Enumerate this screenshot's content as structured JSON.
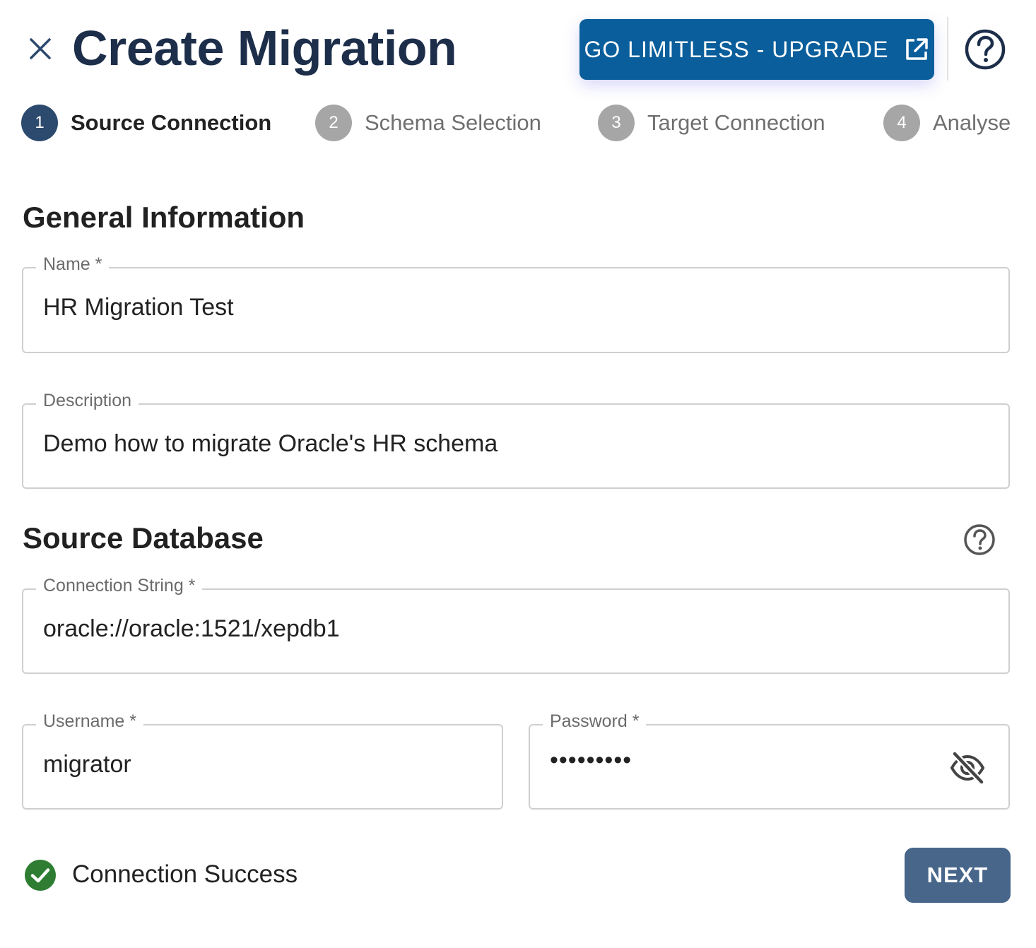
{
  "header": {
    "title": "Create Migration",
    "upgrade_label": "GO LIMITLESS - UPGRADE"
  },
  "stepper": {
    "steps": [
      {
        "number": "1",
        "label": "Source Connection",
        "active": true
      },
      {
        "number": "2",
        "label": "Schema Selection",
        "active": false
      },
      {
        "number": "3",
        "label": "Target Connection",
        "active": false
      },
      {
        "number": "4",
        "label": "Analyse",
        "active": false
      }
    ]
  },
  "general": {
    "title": "General Information",
    "name": {
      "label": "Name *",
      "value": "HR Migration Test"
    },
    "description": {
      "label": "Description",
      "value": "Demo how to migrate Oracle's HR schema"
    }
  },
  "source": {
    "title": "Source Database",
    "connection_string": {
      "label": "Connection String *",
      "value": "oracle://oracle:1521/xepdb1"
    },
    "username": {
      "label": "Username *",
      "value": "migrator"
    },
    "password": {
      "label": "Password *",
      "value": "•••••••••"
    }
  },
  "footer": {
    "status_text": "Connection Success",
    "next_label": "NEXT"
  },
  "colors": {
    "title": "#1d2e4a",
    "upgrade_button": "#0a5e9b",
    "active_step": "#2c4a6e",
    "inactive_step": "#a6a6a6",
    "success": "#2e7d32",
    "next_button": "#47668a"
  },
  "icons": {
    "close": "close-icon",
    "external_link": "external-link-icon",
    "help": "help-circle-icon",
    "visibility_off": "eye-off-icon",
    "success": "check-circle-icon"
  }
}
